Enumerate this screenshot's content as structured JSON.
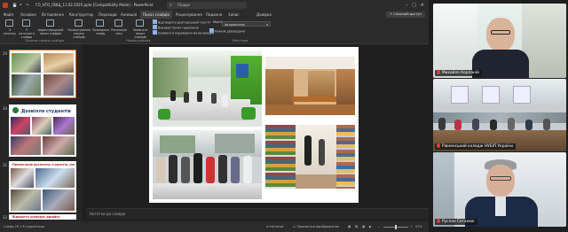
{
  "window": {
    "title": "ГО_НТО_ПВЩ_11.02.2025.pptx [Compatibility Mode] - PowerPoint",
    "search_placeholder": "Пошук",
    "share_label": "Спільний доступ"
  },
  "menu": {
    "items": [
      "Файл",
      "Основне",
      "Вставлення",
      "Конструктор",
      "Переходи",
      "Анімація",
      "Показ слайдів",
      "Рецензування",
      "Подання",
      "Запис",
      "Довідка"
    ],
    "active": "Показ слайдів"
  },
  "ribbon": {
    "buttons": [
      {
        "label": "З початку",
        "icon": "play-icon"
      },
      {
        "label": "З поточного слайда",
        "icon": "play-icon"
      },
      {
        "label": "Користувацький показ слайдів",
        "icon": "custom-show-icon"
      },
      {
        "label": "Налаштування показу слайдів",
        "icon": "settings-icon"
      },
      {
        "label": "Приховати слайд",
        "icon": "hide-slide-icon"
      },
      {
        "label": "Репетиція часу",
        "icon": "timer-icon"
      },
      {
        "label": "Записати показ слайдів",
        "icon": "record-icon"
      }
    ],
    "checkboxes": [
      {
        "label": "Відтворити дикторський текст",
        "checked": true
      },
      {
        "label": "Використання проміжків",
        "checked": true
      },
      {
        "label": "Елементи керування мультимедіа",
        "checked": true
      }
    ],
    "monitor_label": "Монітор:",
    "monitor_value": "Автоматично",
    "presenter_view_label": "Режим доповідача",
    "presenter_view_checked": true,
    "groups": [
      "Початок показу слайдів",
      "Налаштування",
      "Монітори"
    ]
  },
  "thumbnails": {
    "numbers": [
      "29",
      "30",
      "31",
      "32"
    ],
    "slide30_title": "Дозвілля студентів",
    "slide31_title": "Презентація досягнень студентів, спеціальність",
    "slide32_title": "Відкриття осередку дизайну"
  },
  "notes_placeholder": "Нотатки до слайда",
  "status": {
    "slide_info": "Слайд 29 з 32",
    "language": "українська",
    "notes": "Нотатки",
    "display": "Параметри відображення",
    "zoom": "52%"
  },
  "participants": [
    {
      "name": "Михайло Корпаній",
      "icon": "mic-muted-icon"
    },
    {
      "name": "Рівненський коледж НУБІП України",
      "icon": "mic-muted-icon"
    },
    {
      "name": "Руслан Сеганюк",
      "icon": "mic-muted-icon"
    }
  ],
  "colors": {
    "app_bg": "#202020",
    "accent": "#8fb3e6",
    "selected_slide": "#e0651e",
    "mic_muted": "#e03a3a"
  }
}
